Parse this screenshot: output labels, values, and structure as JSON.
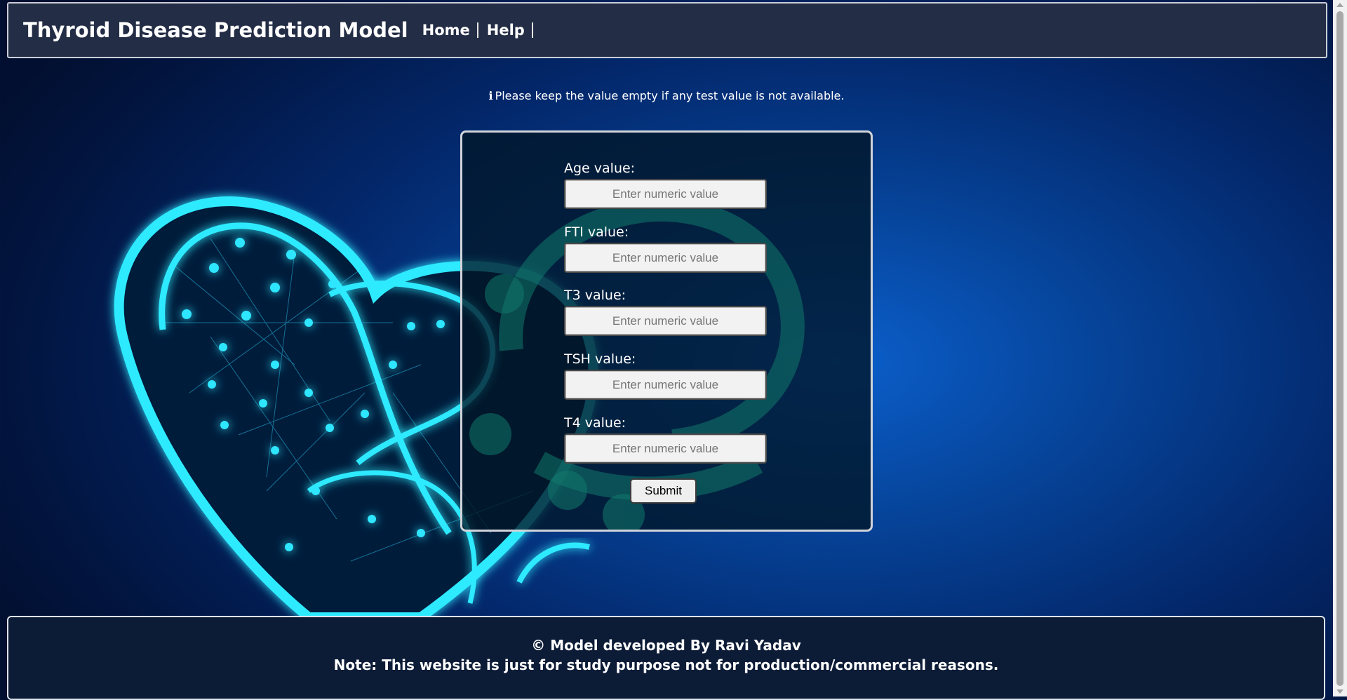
{
  "navbar": {
    "brand": "Thyroid Disease Prediction Model",
    "links": [
      {
        "label": "Home"
      },
      {
        "label": "Help"
      }
    ]
  },
  "notice": {
    "icon": "info-icon",
    "icon_glyph": "ℹ",
    "text": "Please keep the value empty if any test value is not available."
  },
  "form": {
    "fields": [
      {
        "label": "Age value:",
        "placeholder": "Enter numeric value",
        "value": ""
      },
      {
        "label": "FTI value:",
        "placeholder": "Enter numeric value",
        "value": ""
      },
      {
        "label": "T3 value:",
        "placeholder": "Enter numeric value",
        "value": ""
      },
      {
        "label": "TSH value:",
        "placeholder": "Enter numeric value",
        "value": ""
      },
      {
        "label": "T4 value:",
        "placeholder": "Enter numeric value",
        "value": ""
      }
    ],
    "submit_label": "Submit"
  },
  "footer": {
    "line1": "© Model developed By Ravi Yadav",
    "line2": "Note: This website is just for study purpose not for production/commercial reasons."
  },
  "colors": {
    "navbar_bg": "#232d45",
    "footer_bg": "#0c1b36",
    "background_blue": "#0b5fcc",
    "heart_glow": "#28e6ff"
  }
}
